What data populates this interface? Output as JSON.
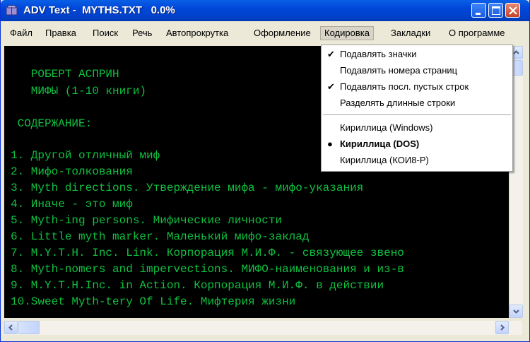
{
  "window": {
    "title": "ADV Text -  MYTHS.TXT   0.0%"
  },
  "menu": {
    "items": [
      "Файл",
      "Правка",
      "Поиск",
      "Речь",
      "Автопрокрутка",
      "Оформление",
      "Кодировка",
      "Закладки",
      "О программе"
    ],
    "active": "Кодировка"
  },
  "dropdown": {
    "items": [
      {
        "label": "Подавлять значки",
        "mark": "✔"
      },
      {
        "label": "Подавлять номера страниц",
        "mark": ""
      },
      {
        "label": "Подавлять посл. пустых строк",
        "mark": "✔"
      },
      {
        "label": "Разделять длинные строки",
        "mark": ""
      },
      {
        "label": "Кириллица (Windows)",
        "mark": ""
      },
      {
        "label": "Кириллица (DOS)",
        "mark": "●"
      },
      {
        "label": "Кириллица (КОИ8-Р)",
        "mark": ""
      }
    ]
  },
  "document": {
    "lines": [
      "   РОБЕРТ АСПРИН",
      "   МИФЫ (1-10 книги)",
      " СОДЕРЖАНИЕ:",
      "1. Другой отличный миф",
      "2. Мифо-толкования",
      "3. Myth directions. Утверждение мифа - мифо-указания",
      "4. Иначе - это миф",
      "5. Myth-ing persons. Мифические личности",
      "6. Little myth marker. Маленький мифо-заклад",
      "7. M.Y.T.H. Inc. Link. Корпорация М.И.Ф. - связующее звено",
      "8. Myth-nomers and impervections. МИФО-наименования и из-в",
      "9. M.Y.T.H.Inc. in Action. Корпорация М.И.Ф. в действии",
      "10.Sweet Myth-tery Of Life. Мифтерия жизни"
    ]
  },
  "colors": {
    "text": "#10c040",
    "background": "#000000",
    "titlebar": "#0046d8"
  }
}
